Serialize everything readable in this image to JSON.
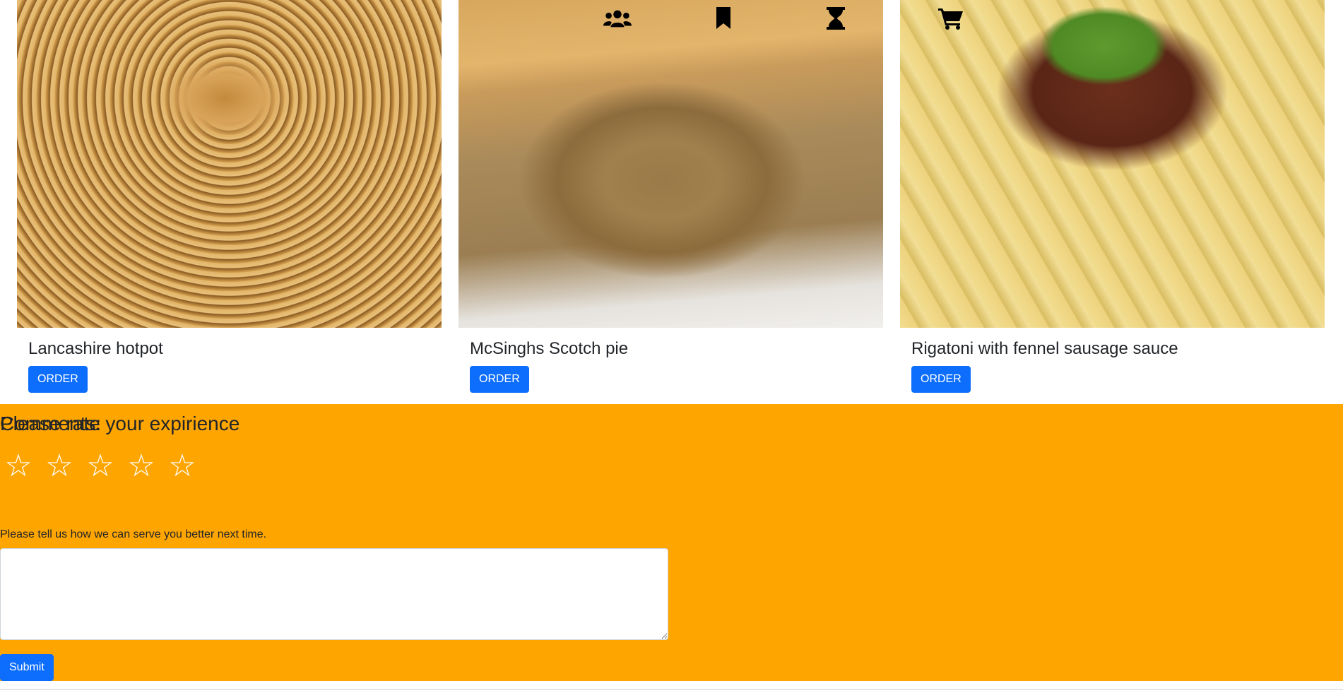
{
  "nav": {
    "icons": [
      {
        "name": "users-icon"
      },
      {
        "name": "bookmark-icon"
      },
      {
        "name": "hourglass-icon"
      },
      {
        "name": "cart-icon"
      }
    ]
  },
  "cards": [
    {
      "title": "Lancashire hotpot",
      "button": "ORDER",
      "image": "hotpot-image"
    },
    {
      "title": "McSinghs Scotch pie",
      "button": "ORDER",
      "image": "scotch-pie-image"
    },
    {
      "title": "Rigatoni with fennel sausage sauce",
      "button": "ORDER",
      "image": "rigatoni-image"
    }
  ],
  "rating": {
    "heading": "Please rate your expirience",
    "star_glyph": "☆",
    "stars_selected": 0,
    "stars_total": 5,
    "comments_label": "Comments:",
    "comments_help": "Please tell us how we can serve you better next time.",
    "comments_value": "",
    "submit_label": "Submit"
  },
  "colors": {
    "accent": "#0d6efd",
    "rating_bg": "#ffa500"
  }
}
